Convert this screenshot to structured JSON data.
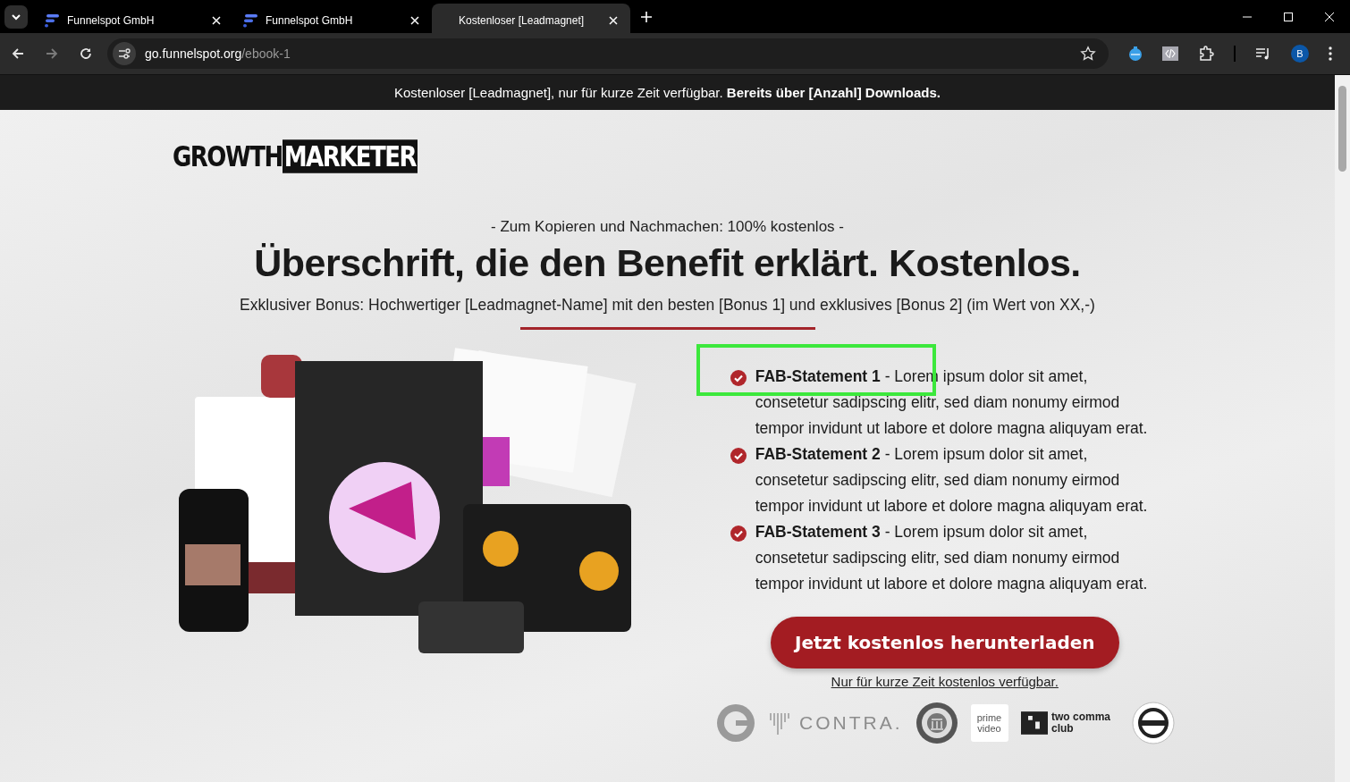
{
  "browser": {
    "tabs": [
      {
        "title": "Funnelspot GmbH",
        "selected": false,
        "favicon": true
      },
      {
        "title": "Funnelspot GmbH",
        "selected": false,
        "favicon": true
      },
      {
        "title": "Kostenloser [Leadmagnet]",
        "selected": true,
        "favicon": false
      }
    ],
    "address": {
      "host": "go.funnelspot.org",
      "path": "/ebook-1"
    },
    "forward_disabled": true,
    "profile_initial": "B"
  },
  "banner": "Kostenloser [Leadmagnet], nur für kurze Zeit verfügbar. **Bereits über [Anzahl] Downloads.**",
  "logo": {
    "part_1": "GROWTH",
    "part_2": "MARKETER"
  },
  "kicker": "- Zum Kopieren und Nachmachen: 100% kostenlos -",
  "headline": "Überschrift, die den Benefit erklärt. Kostenlos.",
  "subline": "Exklusiver Bonus: Hochwertiger [Leadmagnet-Name] mit den besten [Bonus 1] und exklusives [Bonus 2] (im Wert von XX,-)",
  "statements": [
    {
      "text": "**FAB-Statement 1** - Lorem ipsum dolor sit amet, consetetur sadipscing elitr, sed diam nonumy eirmod tempor invidunt ut labore et dolore magna aliquyam erat.",
      "highlighted": true
    },
    {
      "text": "**FAB-Statement 2** - Lorem ipsum dolor sit amet, consetetur sadipscing elitr, sed diam nonumy eirmod tempor invidunt ut labore et dolore magna aliquyam erat.",
      "highlighted": false
    },
    {
      "text": "**FAB-Statement 3** - Lorem ipsum dolor sit amet, consetetur sadipscing elitr, sed diam nonumy eirmod tempor invidunt ut labore et dolore magna aliquyam erat.",
      "highlighted": false
    }
  ],
  "cta": "Jetzt kostenlos herunterladen",
  "note": "Nur für kurze Zeit kostenlos verfügbar.",
  "press_logos": [
    {
      "kind": "g-mark"
    },
    {
      "kind": "wordmark",
      "text": "CONTRA."
    },
    {
      "kind": "seal"
    },
    {
      "kind": "tile",
      "text": "prime video"
    },
    {
      "kind": "club",
      "text": "two comma club"
    },
    {
      "kind": "ring"
    }
  ]
}
